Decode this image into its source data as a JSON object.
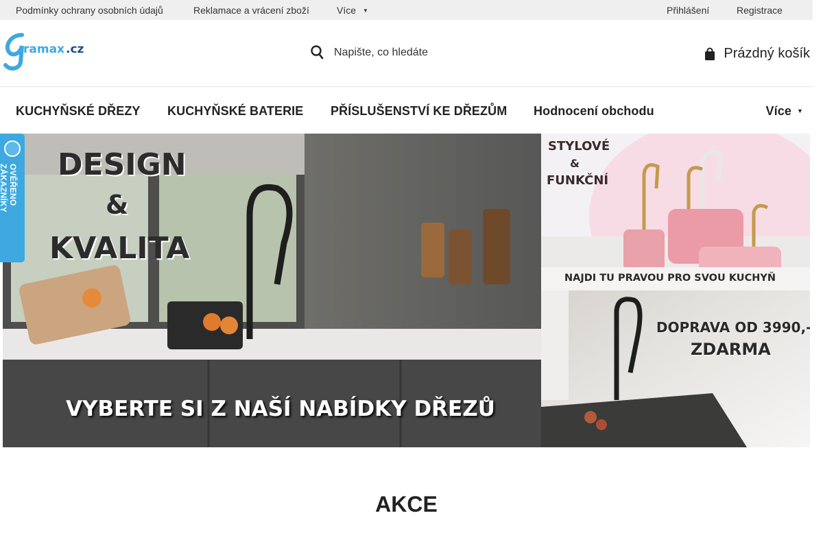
{
  "topbar": {
    "links": [
      "Podmínky ochrany osobních údajů",
      "Reklamace a vrácení zboží"
    ],
    "more_label": "Více",
    "login_label": "Přihlášení",
    "register_label": "Registrace"
  },
  "header": {
    "logo_text": "gramax.cz",
    "search_placeholder": "Napište, co hledáte",
    "cart_label": "Prázdný košík"
  },
  "nav": {
    "items": [
      "KUCHYŇSKÉ DŘEZY",
      "KUCHYŇSKÉ BATERIE",
      "PŘÍSLUŠENSTVÍ KE DŘEZŮM",
      "Hodnocení obchodu"
    ],
    "more_label": "Více"
  },
  "banners": {
    "main": {
      "line1": "DESIGN",
      "line2": "&",
      "line3": "KVALITA",
      "bottom": "VYBERTE SI Z NAŠÍ NABÍDKY DŘEZŮ"
    },
    "right_top": {
      "line1": "STYLOVÉ",
      "line2": "&",
      "line3": "FUNKČNÍ",
      "bottom": "NAJDI TU PRAVOU PRO SVOU KUCHYŇ"
    },
    "right_bottom": {
      "line1": "DOPRAVA OD 3990,-",
      "line2": "ZDARMA"
    }
  },
  "badge": {
    "label": "OVĚŘENO ZÁKAZNÍKY"
  },
  "section": {
    "title": "AKCE"
  },
  "colors": {
    "brand_blue": "#3da9e0",
    "topbar_bg": "#efefef",
    "text": "#222222"
  }
}
